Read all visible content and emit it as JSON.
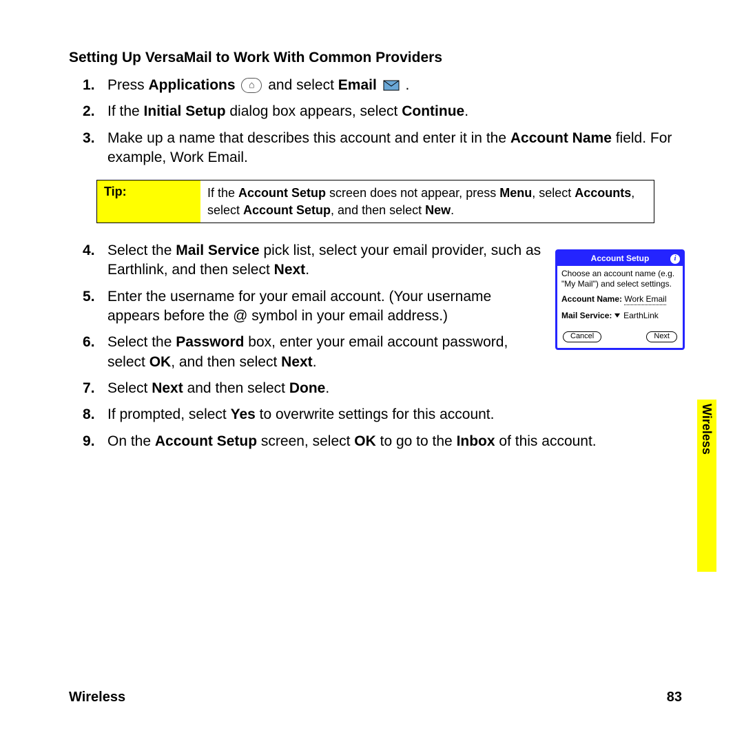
{
  "heading": "Setting Up VersaMail to Work With Common Providers",
  "steps_part1": {
    "s1_a": "Press ",
    "s1_app": "Applications",
    "s1_b": " and select ",
    "s1_email": "Email",
    "s1_c": " .",
    "s2_a": "If the ",
    "s2_is": "Initial Setup",
    "s2_b": " dialog box appears, select ",
    "s2_cont": "Continue",
    "s2_c": ".",
    "s3_a": "Make up a name that describes this account and enter it in the ",
    "s3_an": "Account Name",
    "s3_b": " field. For example, Work Email."
  },
  "tip": {
    "label": "Tip:",
    "a": "If the ",
    "as": "Account Setup",
    "b": " screen does not appear, press ",
    "menu": "Menu",
    "c": ", select ",
    "acc": "Accounts",
    "d": ", select ",
    "as2": "Account Setup",
    "e": ", and then select ",
    "new": "New",
    "f": "."
  },
  "steps_part2": {
    "s4_a": "Select the ",
    "s4_ms": "Mail Service",
    "s4_b": " pick list, select your email provider, such as Earthlink, and then select ",
    "s4_next": "Next",
    "s4_c": ".",
    "s5": "Enter the username for your email account. (Your username appears before the @ symbol in your email address.)",
    "s6_a": "Select the ",
    "s6_pw": "Password",
    "s6_b": " box, enter your email account password, select ",
    "s6_ok": "OK",
    "s6_c": ", and then select ",
    "s6_next": "Next",
    "s6_d": ".",
    "s7_a": "Select ",
    "s7_next": "Next",
    "s7_b": " and then select ",
    "s7_done": "Done",
    "s7_c": ".",
    "s8_a": "If prompted, select ",
    "s8_yes": "Yes",
    "s8_b": " to overwrite settings for this account.",
    "s9_a": "On the ",
    "s9_as": "Account Setup",
    "s9_b": " screen, select ",
    "s9_ok": "OK",
    "s9_c": " to go to the ",
    "s9_inbox": "Inbox",
    "s9_d": " of this account."
  },
  "palm": {
    "title": "Account Setup",
    "info": "i",
    "instr1": "Choose an account name (e.g.",
    "instr2": "\"My Mail\") and select settings.",
    "acct_label": "Account Name:",
    "acct_value": "Work Email",
    "ms_label": "Mail Service:",
    "ms_value": "EarthLink",
    "cancel": "Cancel",
    "next": "Next"
  },
  "side_tab": "Wireless",
  "footer": {
    "section": "Wireless",
    "page": "83"
  }
}
